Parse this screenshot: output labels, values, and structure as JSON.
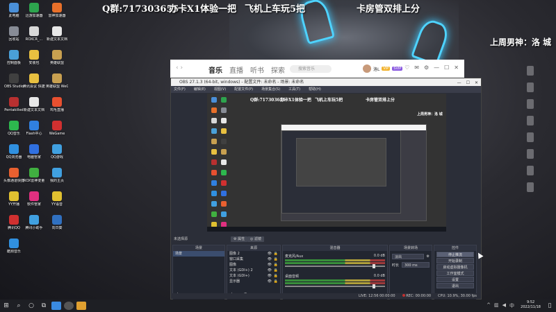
{
  "overlay": {
    "qq_group": "Q群:717303655",
    "event1": "办卡X1体验一把",
    "event2": "飞机上车玩5把",
    "event3": "卡房管双排上分",
    "weekly_god": "上周男神：洛 城"
  },
  "desktop_icons": [
    {
      "label": "此电脑",
      "color": "#4a8fd8"
    },
    {
      "label": "迅游加速器",
      "color": "#2da44e"
    },
    {
      "label": "雷神加速器",
      "color": "#e8702a"
    },
    {
      "label": "回收站",
      "color": "#888c96"
    },
    {
      "label": "ROXCR_...",
      "color": "#d8d8d8"
    },
    {
      "label": "新建文本文档",
      "color": "#e8e8e8"
    },
    {
      "label": "控制面板",
      "color": "#4aa0d8"
    },
    {
      "label": "安装包",
      "color": "#e8c040"
    },
    {
      "label": "英雄联盟",
      "color": "#c8a050"
    },
    {
      "label": "OBS Studio",
      "color": "#404040"
    },
    {
      "label": "腾讯会议 快捷方式",
      "color": "#e8c040"
    },
    {
      "label": "英雄联盟 WeGame版",
      "color": "#c8a050"
    },
    {
      "label": "Pentakilled",
      "color": "#b83030"
    },
    {
      "label": "新建文本文档",
      "color": "#e8e8e8"
    },
    {
      "label": "鸡毛直播",
      "color": "#e85030"
    },
    {
      "label": "QQ音乐",
      "color": "#2db84e"
    },
    {
      "label": "Flash中心",
      "color": "#3080e0"
    },
    {
      "label": "WeGame",
      "color": "#d03030"
    },
    {
      "label": "QQ浏览器",
      "color": "#3090e0"
    },
    {
      "label": "电脑管家",
      "color": "#3070e0"
    },
    {
      "label": "QQ游戏",
      "color": "#40a0e0"
    },
    {
      "label": "头像通道快捷",
      "color": "#e86030"
    },
    {
      "label": "ROX雷神变量",
      "color": "#40b040"
    },
    {
      "label": "我的主页",
      "color": "#40a0e0"
    },
    {
      "label": "YY开播",
      "color": "#e0c030"
    },
    {
      "label": "软件管家",
      "color": "#e03080"
    },
    {
      "label": "YY语音",
      "color": "#e0c030"
    },
    {
      "label": "腾讯QQ",
      "color": "#d03030"
    },
    {
      "label": "腾讯小助手",
      "color": "#40a0e0"
    },
    {
      "label": "向日葵",
      "color": "#3070c0"
    },
    {
      "label": "酷狗音乐",
      "color": "#3090e0"
    }
  ],
  "music_app": {
    "tabs": [
      "音乐",
      "直播",
      "听书",
      "探索"
    ],
    "search_placeholder": "搜索音乐",
    "username": "洛L",
    "badge1": "VIP",
    "badge2": "SVIP"
  },
  "obs": {
    "title": "OBS 27.1.3 (64-bit, windows) - 配置文件: 未命名 - 场景: 未命名",
    "menu": [
      "文件(F)",
      "编辑(E)",
      "视图(V)",
      "配置文件(P)",
      "场景集合(S)",
      "工具(T)",
      "帮助(H)"
    ],
    "preview_overlay": {
      "qq_group": "Q群:717303655",
      "event1": "办卡X1体验一把",
      "event2": "飞机上车玩5把",
      "event3": "卡房管双排上分",
      "weekly_god": "上周男神：洛 城"
    },
    "sub_bar_label": "未选择源",
    "properties_btn": "属性",
    "filter_btn": "滤镜",
    "docks": {
      "scenes_title": "场景",
      "scenes": [
        "场景"
      ],
      "sources_title": "来源",
      "sources": [
        "图像 2",
        "窗口采集",
        "图像",
        "文本 (GDI+) 2",
        "文本 (GDI+)",
        "显示器"
      ],
      "mixer_title": "混音器",
      "mixer_tracks": [
        {
          "name": "麦克风/Aux",
          "db": "0.0 dB"
        },
        {
          "name": "桌面音频",
          "db": "0.0 dB"
        }
      ],
      "transitions_title": "场景转场",
      "transition_type": "淡出",
      "duration_label": "时长",
      "duration_value": "300 ms",
      "controls_title": "控件",
      "controls": [
        "停止推流",
        "开始录制",
        "启动虚拟摄像机",
        "工作室模式",
        "设置",
        "退出"
      ]
    },
    "status": {
      "live_label": "LIVE: 12:56",
      "live_time": "00:00:00",
      "rec_label": "REC:",
      "rec_time": "00:00:00",
      "cpu": "CPU: 10.9%, 30.00 fps"
    }
  },
  "taskbar": {
    "time": "9:52",
    "date": "2022/11/18"
  }
}
